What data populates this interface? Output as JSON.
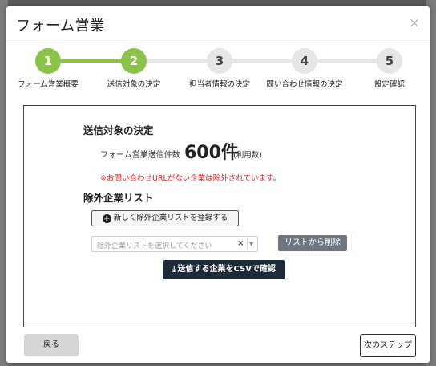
{
  "modal": {
    "title": "フォーム営業",
    "close_glyph": "×"
  },
  "stepper": {
    "steps": [
      {
        "number": "1",
        "label": "フォーム営業概要",
        "done": true
      },
      {
        "number": "2",
        "label": "送信対象の決定",
        "done": true
      },
      {
        "number": "3",
        "label": "担当者情報の決定",
        "done": false
      },
      {
        "number": "4",
        "label": "問い合わせ情報の決定",
        "done": false
      },
      {
        "number": "5",
        "label": "設定確認",
        "done": false
      }
    ],
    "done_color": "#8bc34a",
    "pending_color": "#e6e6e6"
  },
  "content": {
    "target_title": "送信対象の決定",
    "count_label": "フォーム営業送信件数",
    "count_value": "600件",
    "count_unit": "(利用数)",
    "warning": "※お問い合わせURLがない企業は除外されています。",
    "exclude_title": "除外企業リスト",
    "register_button": "新しく除外企業リストを登録する",
    "select_placeholder": "除外企業リストを選択してください",
    "select_clear": "×",
    "select_arrow": "▼",
    "remove_button": "リストから削除",
    "csv_button": "送信する企業をCSVで確認",
    "warning_color": "#e32222"
  },
  "footer": {
    "back_button": "戻る",
    "next_button": "次のステップ"
  }
}
